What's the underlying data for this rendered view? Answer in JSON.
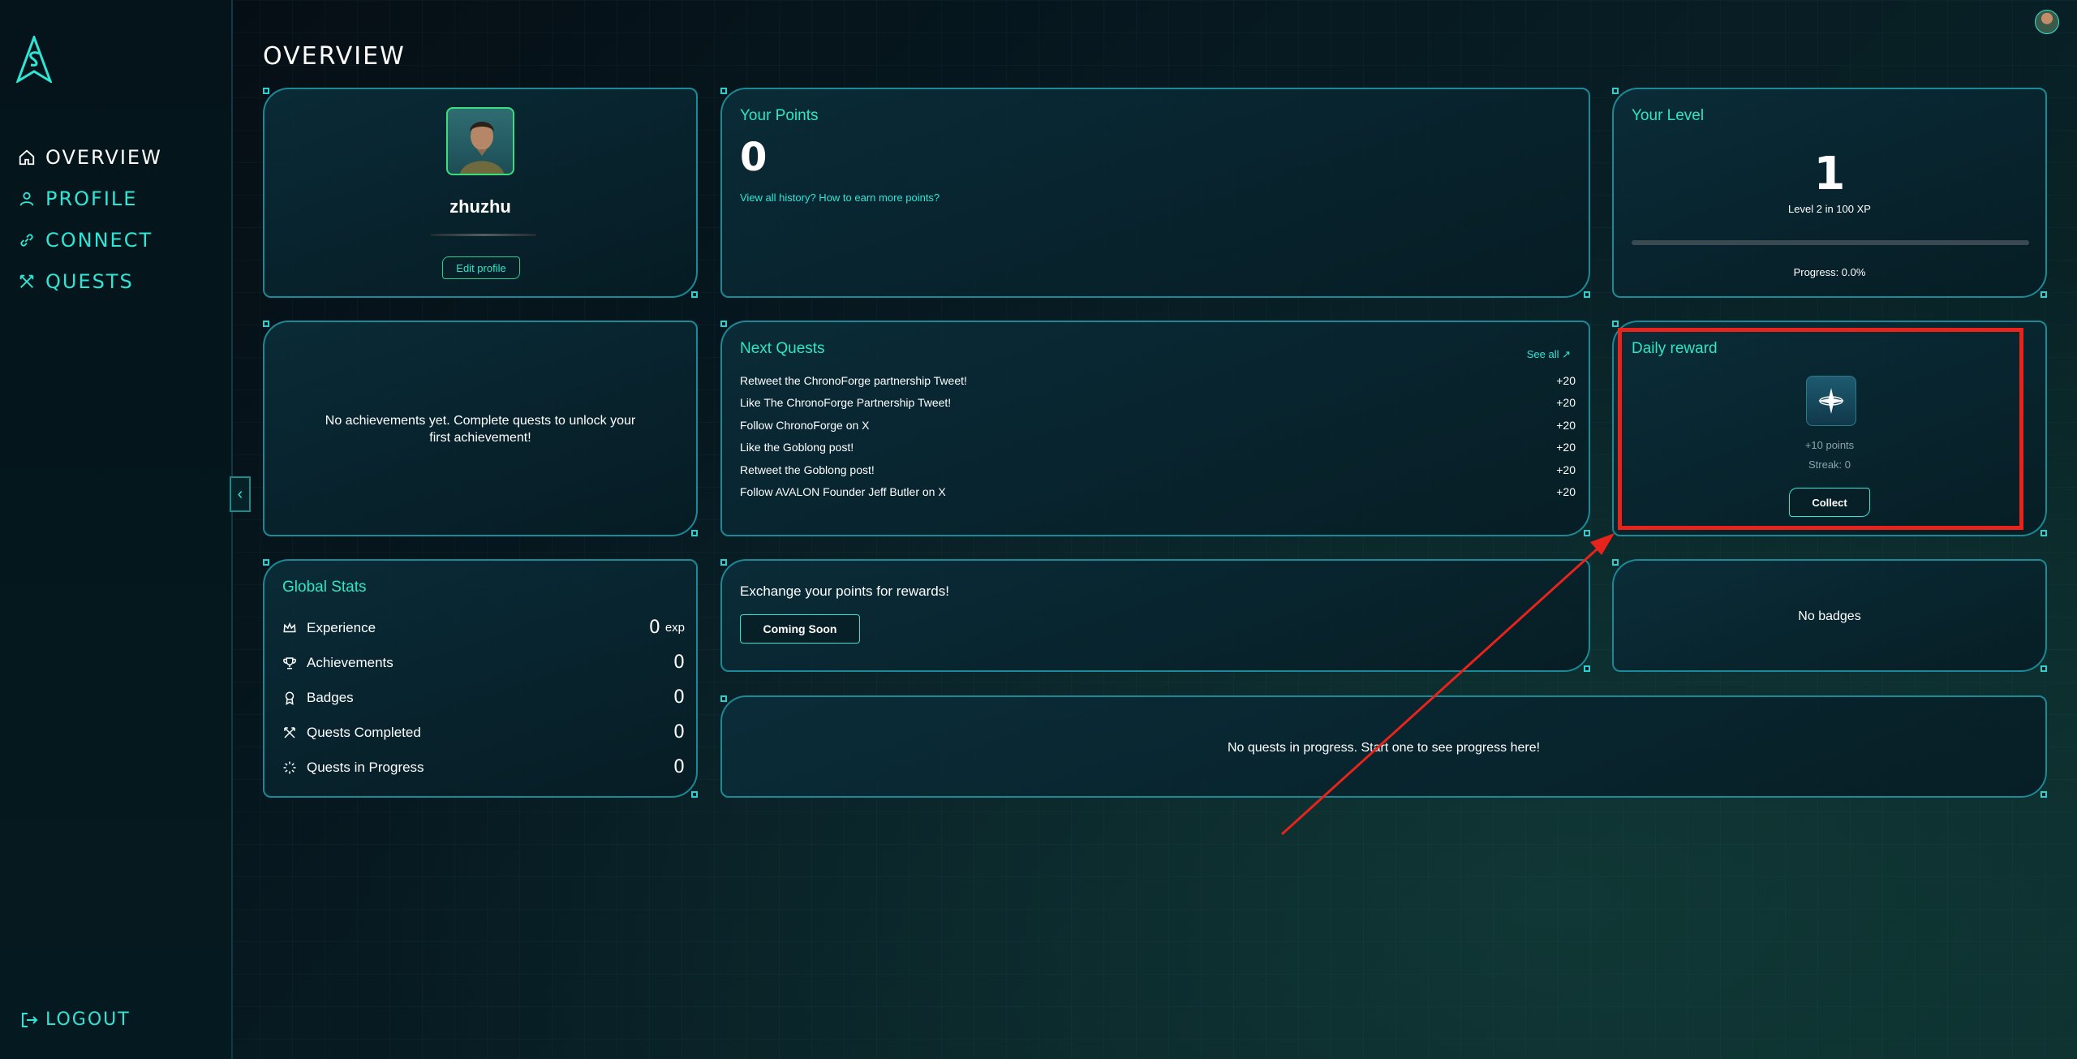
{
  "sidebar": {
    "items": [
      {
        "label": "OVERVIEW",
        "icon": "home-icon"
      },
      {
        "label": "PROFILE",
        "icon": "user-icon"
      },
      {
        "label": "CONNECT",
        "icon": "link-icon"
      },
      {
        "label": "QUESTS",
        "icon": "swords-icon"
      }
    ],
    "logout_label": "LOGOUT",
    "collapse_glyph": "‹"
  },
  "page": {
    "title": "OVERVIEW"
  },
  "profile": {
    "username": "zhuzhu",
    "edit_label": "Edit profile"
  },
  "points": {
    "title": "Your Points",
    "value": "0",
    "links": "View all history? How to earn more points?"
  },
  "level": {
    "title": "Your Level",
    "value": "1",
    "subtitle": "Level 2 in 100 XP",
    "progress": 0.0,
    "progress_text": "Progress: 0.0%"
  },
  "achievements": {
    "empty_text": "No achievements yet. Complete quests to unlock your first achievement!"
  },
  "next_quests": {
    "title": "Next Quests",
    "see_all": "See all",
    "items": [
      {
        "name": "Retweet the ChronoForge partnership Tweet!",
        "points": "+20"
      },
      {
        "name": "Like The ChronoForge Partnership Tweet!",
        "points": "+20"
      },
      {
        "name": "Follow ChronoForge on X",
        "points": "+20"
      },
      {
        "name": "Like the Goblong post!",
        "points": "+20"
      },
      {
        "name": "Retweet the Goblong post!",
        "points": "+20"
      },
      {
        "name": "Follow AVALON Founder Jeff Butler on X",
        "points": "+20"
      }
    ]
  },
  "daily_reward": {
    "title": "Daily reward",
    "points": "+10 points",
    "streak": "Streak: 0",
    "collect_label": "Collect"
  },
  "global_stats": {
    "title": "Global Stats",
    "rows": [
      {
        "label": "Experience",
        "value": "0",
        "unit": "exp",
        "icon": "crown-icon"
      },
      {
        "label": "Achievements",
        "value": "0",
        "unit": "",
        "icon": "trophy-icon"
      },
      {
        "label": "Badges",
        "value": "0",
        "unit": "",
        "icon": "badge-icon"
      },
      {
        "label": "Quests Completed",
        "value": "0",
        "unit": "",
        "icon": "swords-icon"
      },
      {
        "label": "Quests in Progress",
        "value": "0",
        "unit": "",
        "icon": "loader-icon"
      }
    ]
  },
  "exchange": {
    "text": "Exchange your points for rewards!",
    "button": "Coming Soon"
  },
  "badges": {
    "empty_text": "No badges"
  },
  "progress": {
    "empty_text": "No quests in progress. Start one to see progress here!"
  },
  "colors": {
    "accent": "#2ee6c6",
    "annotation": "#e8231b"
  }
}
